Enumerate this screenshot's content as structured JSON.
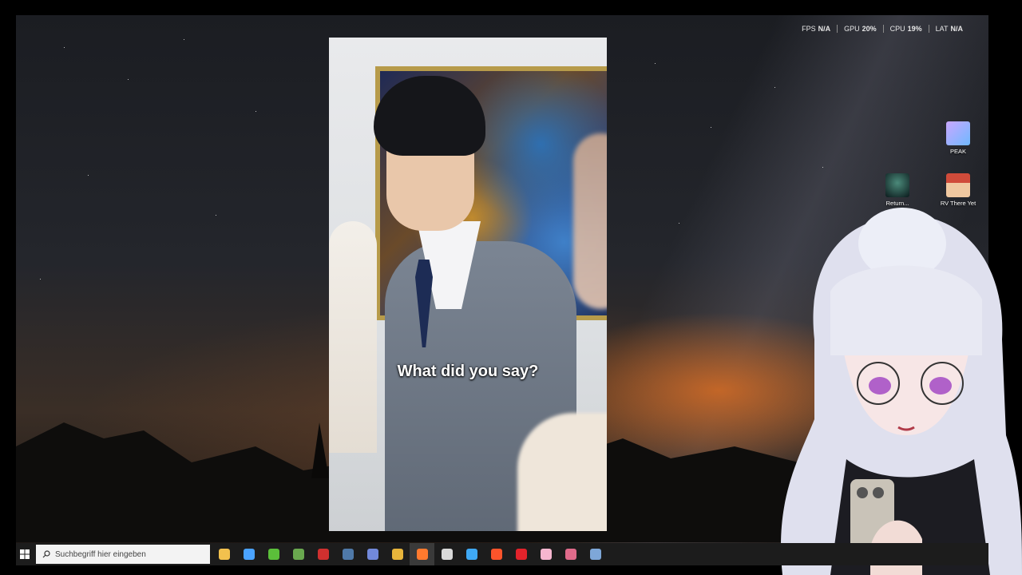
{
  "overlay": {
    "fps_label": "FPS",
    "fps_value": "N/A",
    "gpu_label": "GPU",
    "gpu_value": "20%",
    "cpu_label": "CPU",
    "cpu_value": "19%",
    "lat_label": "LAT",
    "lat_value": "N/A"
  },
  "video": {
    "subtitle": "What did you say?"
  },
  "desktop_icons": [
    {
      "label": "PEAK",
      "icon": "peak-game-icon"
    },
    {
      "label": "Return...",
      "icon": "return-game-icon"
    },
    {
      "label": "RV There Yet",
      "icon": "rv-there-yet-icon"
    }
  ],
  "taskbar": {
    "search_placeholder": "Suchbegriff hier eingeben",
    "apps": [
      {
        "name": "file-explorer",
        "color": "#f2c14e"
      },
      {
        "name": "store",
        "color": "#4aa3ff"
      },
      {
        "name": "xbox",
        "color": "#5bbf3a"
      },
      {
        "name": "minecraft",
        "color": "#6aa84f"
      },
      {
        "name": "game-app",
        "color": "#d0302f"
      },
      {
        "name": "steam",
        "color": "#4f79a8"
      },
      {
        "name": "discord",
        "color": "#7289da"
      },
      {
        "name": "chrome",
        "color": "#e7b43b"
      },
      {
        "name": "firefox",
        "color": "#ff7a2e",
        "active": true
      },
      {
        "name": "obs",
        "color": "#d9d9d9"
      },
      {
        "name": "app-blue",
        "color": "#3fa9f5"
      },
      {
        "name": "brave",
        "color": "#fb542b"
      },
      {
        "name": "opera",
        "color": "#e2232b"
      },
      {
        "name": "app-pink",
        "color": "#f6b6cf"
      },
      {
        "name": "app-bar",
        "color": "#e06b8b"
      },
      {
        "name": "steam-2",
        "color": "#7ea7d8"
      }
    ]
  }
}
